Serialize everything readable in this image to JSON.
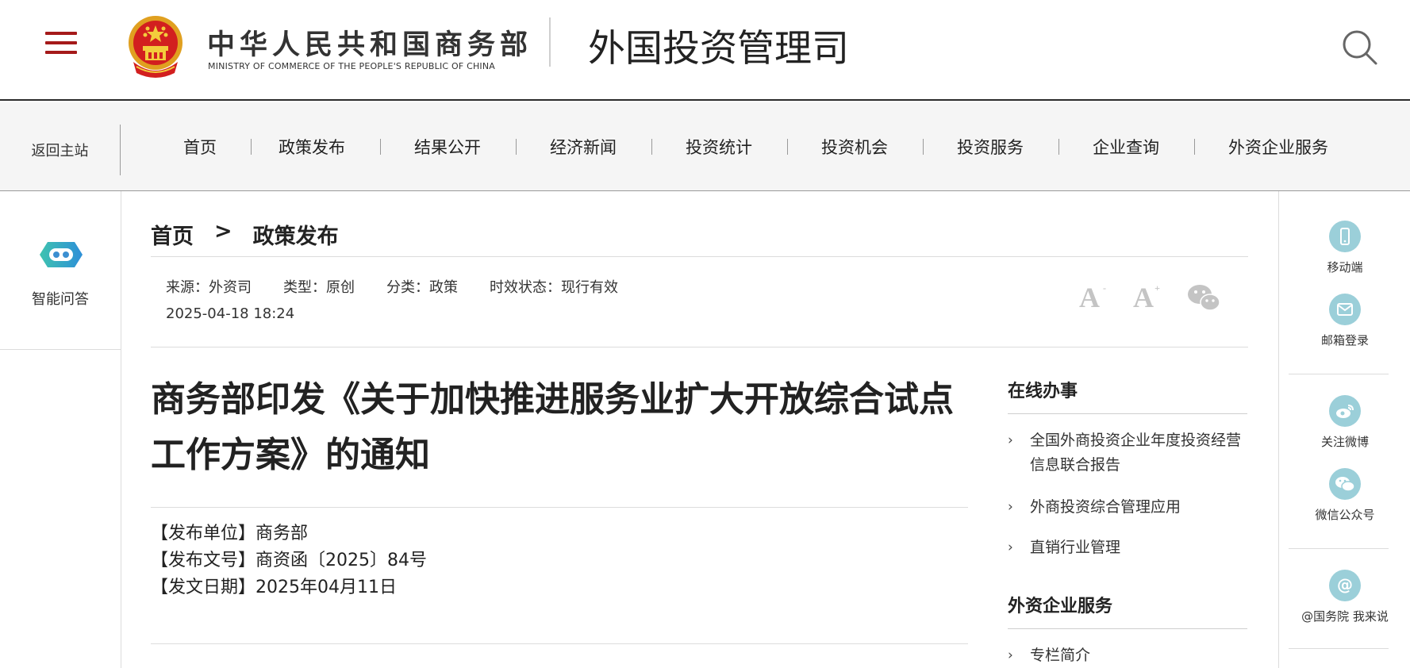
{
  "header": {
    "ministry_cn": "中华人民共和国商务部",
    "ministry_en": "MINISTRY OF COMMERCE OF THE PEOPLE'S REPUBLIC OF CHINA",
    "dept_title": "外国投资管理司",
    "menu_icon": "hamburger-menu-icon",
    "search_icon": "search-icon",
    "emblem_icon": "national-emblem-icon",
    "accent_color": "#a51a1a"
  },
  "nav": {
    "back_label": "返回主站",
    "items": [
      "首页",
      "政策发布",
      "结果公开",
      "经济新闻",
      "投资统计",
      "投资机会",
      "投资服务",
      "企业查询",
      "外资企业服务"
    ]
  },
  "left_rail": {
    "ai_label": "智能问答",
    "ai_icon": "robot-icon"
  },
  "breadcrumb": {
    "home": "首页",
    "separator": ">",
    "current": "政策发布"
  },
  "meta": {
    "source": "来源：外资司",
    "type": "类型：原创",
    "category": "分类：政策",
    "status": "时效状态：现行有效",
    "date": "2025-04-18 18:24"
  },
  "font_tools": {
    "decrease": "A",
    "decrease_sup": "-",
    "increase": "A",
    "increase_sup": "+",
    "share_icon": "wechat-icon"
  },
  "article": {
    "title": "商务部印发《关于加快推进服务业扩大开放综合试点工作方案》的通知",
    "issuer": "【发布单位】商务部",
    "doc_number": "【发布文号】商资函〔2025〕84号",
    "issue_date": "【发文日期】2025年04月11日"
  },
  "sidebar": {
    "online_title": "在线办事",
    "online_links": [
      "全国外商投资企业年度投资经营信息联合报告",
      "外商投资综合管理应用",
      "直销行业管理"
    ],
    "service_title": "外资企业服务",
    "service_links": [
      "专栏简介"
    ]
  },
  "right_rail": {
    "items": [
      {
        "label": "移动端",
        "icon": "mobile-icon"
      },
      {
        "label": "邮箱登录",
        "icon": "mail-icon"
      },
      {
        "label": "关注微博",
        "icon": "weibo-icon"
      },
      {
        "label": "微信公众号",
        "icon": "wechat-icon"
      },
      {
        "label": "@国务院 我来说",
        "icon": "at-icon"
      }
    ],
    "icon_color": "#9bcfd9"
  }
}
